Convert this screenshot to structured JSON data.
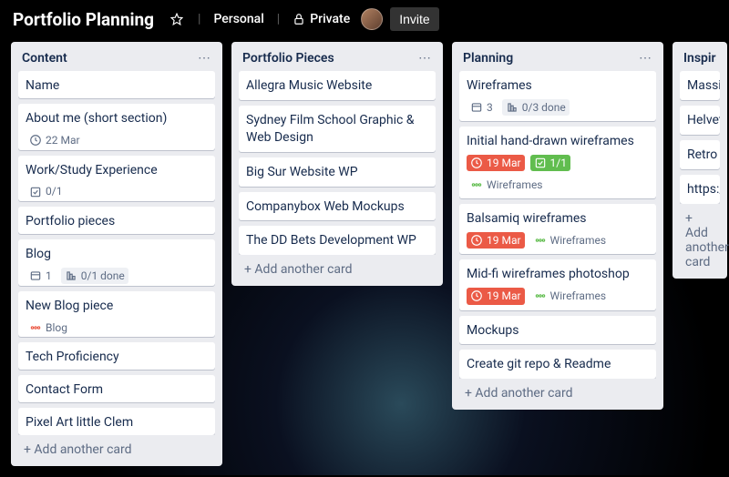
{
  "header": {
    "title": "Portfolio Planning",
    "star_state": "unstarred",
    "visibility_team": "Personal",
    "visibility_level": "Private",
    "invite_label": "Invite"
  },
  "lists": [
    {
      "title": "Content",
      "add_label": "+ Add another card",
      "cards": [
        {
          "title": "Name"
        },
        {
          "title": "About me (short section)",
          "badges": [
            {
              "type": "due",
              "text": "22 Mar"
            }
          ]
        },
        {
          "title": "Work/Study Experience",
          "badges": [
            {
              "type": "check",
              "text": "0/1"
            }
          ]
        },
        {
          "title": "Portfolio pieces"
        },
        {
          "title": "Blog",
          "badges": [
            {
              "type": "attach",
              "text": "1"
            },
            {
              "type": "progress",
              "text": "0/1 done",
              "boxed": true
            }
          ]
        },
        {
          "title": "New Blog piece",
          "badges": [
            {
              "type": "label-blog",
              "text": "Blog"
            }
          ]
        },
        {
          "title": "Tech Proficiency"
        },
        {
          "title": "Contact Form"
        },
        {
          "title": "Pixel Art little Clem"
        }
      ]
    },
    {
      "title": "Portfolio Pieces",
      "add_label": "+ Add another card",
      "cards": [
        {
          "title": "Allegra Music Website"
        },
        {
          "title": "Sydney Film School Graphic & Web Design",
          "wrap": true
        },
        {
          "title": "Big Sur Website WP"
        },
        {
          "title": "Companybox Web Mockups"
        },
        {
          "title": "The DD Bets Development WP"
        }
      ]
    },
    {
      "title": "Planning",
      "add_label": "+ Add another card",
      "cards": [
        {
          "title": "Wireframes",
          "badges": [
            {
              "type": "attach",
              "text": "3"
            },
            {
              "type": "progress",
              "text": "0/3 done",
              "boxed": true
            }
          ]
        },
        {
          "title": "Initial hand-drawn wireframes",
          "badges": [
            {
              "type": "due-red",
              "text": "19 Mar"
            },
            {
              "type": "done-green",
              "text": "1/1"
            },
            {
              "type": "label-wf",
              "text": "Wireframes"
            }
          ]
        },
        {
          "title": "Balsamiq wireframes",
          "badges": [
            {
              "type": "due-red",
              "text": "19 Mar"
            },
            {
              "type": "label-wf",
              "text": "Wireframes"
            }
          ]
        },
        {
          "title": "Mid-fi wireframes photoshop",
          "badges": [
            {
              "type": "due-red",
              "text": "19 Mar"
            },
            {
              "type": "label-wf",
              "text": "Wireframes"
            }
          ]
        },
        {
          "title": "Mockups"
        },
        {
          "title": "Create git repo & Readme"
        }
      ]
    },
    {
      "title": "Inspiration",
      "add_label": "+ Add another card",
      "truncated": true,
      "cards": [
        {
          "title": "Massimo Vignelli"
        },
        {
          "title": "Helvetica"
        },
        {
          "title": "Retro Design"
        },
        {
          "title": "https://lynnandtonic.com"
        }
      ]
    }
  ]
}
